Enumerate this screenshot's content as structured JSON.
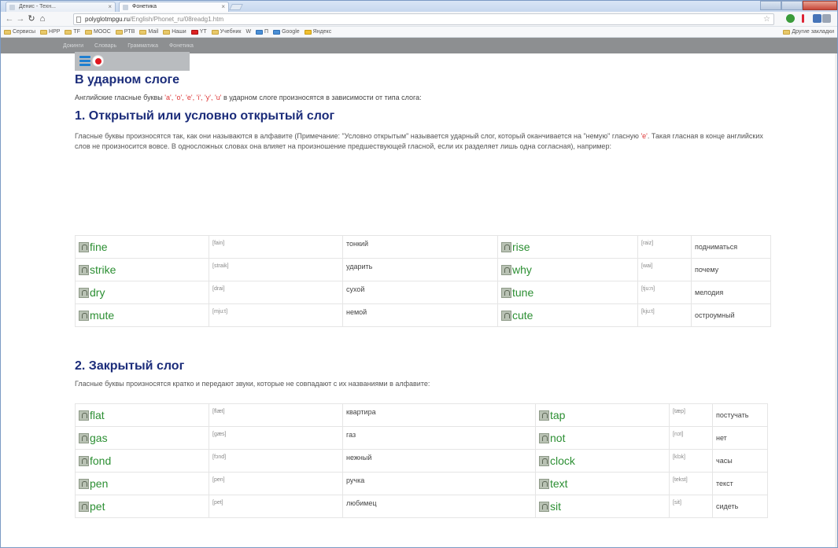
{
  "browser": {
    "tabs": [
      {
        "label": "Денис - Техн...",
        "active": false
      },
      {
        "label": "Фонетика",
        "active": true
      }
    ],
    "address_host": "polyglotmpgu.ru",
    "address_path": "/English/Phonet_ru/08readg1.htm",
    "bookmarks": [
      "Сервисы",
      "HPP",
      "TF",
      "MOOC",
      "PTB",
      "Mail",
      "Наши",
      "YT",
      "Учебник",
      "W",
      "П",
      "Google",
      "Яндекс"
    ],
    "bookmarks_other": "Другие закладки"
  },
  "site_nav": [
    "Докинги",
    "Словарь",
    "Грамматика",
    "Фонетика"
  ],
  "colors": {
    "heading": "#1b2c7a",
    "word": "#2c8f33",
    "vowel": "#dd3333",
    "nav_bg": "#8d8f91"
  },
  "section1": {
    "title": "В ударном слоге",
    "intro_before": "Английские гласные буквы ",
    "vowels": "'a', 'o', 'e', 'i', 'y', 'u'",
    "intro_after": " в ударном слоге произносятся в зависимости от типа слога:"
  },
  "open": {
    "title": "1. Открытый или условно открытый слог",
    "text_a": "Гласные буквы произносятся так, как они называются в алфавите (Примечание: \"Условно открытым\" называется ударный слог, который оканчивается на \"немую\" гласную ",
    "vowel_e": "'e'",
    "text_b": ". Такая гласная в конце английских слов не произносится вовсе. В односложных словах она влияет на произношение предшествующей гласной, если их разделяет лишь одна согласная), например:",
    "rows": [
      {
        "w1": "fine",
        "t1": "[fain]",
        "r1": "тонкий",
        "w2": "rise",
        "t2": "[raiz]",
        "r2": "подниматься"
      },
      {
        "w1": "strike",
        "t1": "[straik]",
        "r1": "ударить",
        "w2": "why",
        "t2": "[wai]",
        "r2": "почему"
      },
      {
        "w1": "dry",
        "t1": "[drai]",
        "r1": "сухой",
        "w2": "tune",
        "t2": "[tju:n]",
        "r2": "мелодия"
      },
      {
        "w1": "mute",
        "t1": "[mju:t]",
        "r1": "немой",
        "w2": "cute",
        "t2": "[kju:t]",
        "r2": "остроумный"
      }
    ]
  },
  "closed": {
    "title": "2. Закрытый слог",
    "text": "Гласные буквы произносятся кратко и передают звуки, которые не совпадают с их названиями в алфавите:",
    "rows": [
      {
        "w1": "flat",
        "t1": "[flæt]",
        "r1": "квартира",
        "w2": "tap",
        "t2": "[tæp]",
        "r2": "постучать"
      },
      {
        "w1": "gas",
        "t1": "[gæs]",
        "r1": "газ",
        "w2": "not",
        "t2": "[nɔt]",
        "r2": "нет"
      },
      {
        "w1": "fond",
        "t1": "[fɔnd]",
        "r1": "нежный",
        "w2": "clock",
        "t2": "[klɔk]",
        "r2": "часы"
      },
      {
        "w1": "pen",
        "t1": "[pen]",
        "r1": "ручка",
        "w2": "text",
        "t2": "[tekst]",
        "r2": "текст"
      },
      {
        "w1": "pet",
        "t1": "[pet]",
        "r1": "любимец",
        "w2": "sit",
        "t2": "[sit]",
        "r2": "сидеть"
      }
    ]
  }
}
